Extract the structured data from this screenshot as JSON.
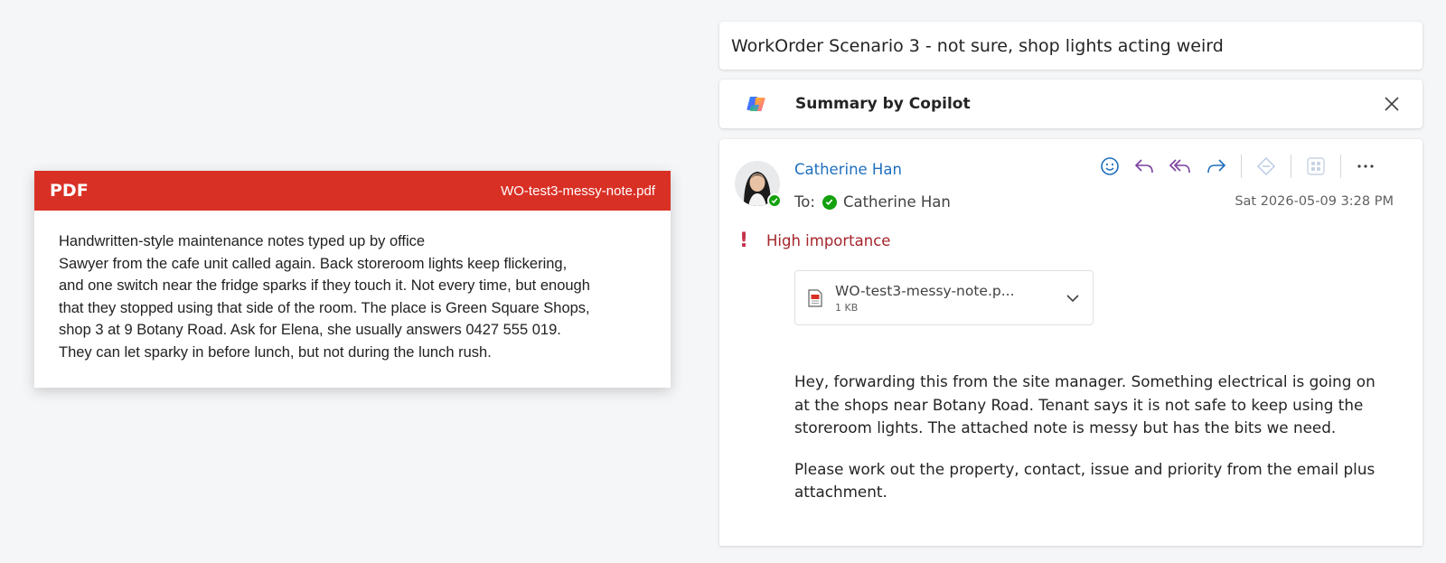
{
  "pdf": {
    "tag": "PDF",
    "filename": "WO-test3-messy-note.pdf",
    "lines": [
      "Handwritten-style maintenance notes typed up by office",
      "Sawyer from the cafe unit called again. Back storeroom lights keep flickering,",
      "and one switch near the fridge sparks if they touch it. Not every time, but enough",
      "that they stopped using that side of the room. The place is Green Square Shops,",
      "shop 3 at 9 Botany Road. Ask for Elena, she usually answers 0427 555 019.",
      "They can let sparky in before lunch, but not during the lunch rush."
    ]
  },
  "email": {
    "subject": "WorkOrder Scenario 3 - not sure, shop lights acting weird",
    "copilot_label": "Summary by Copilot",
    "sender": "Catherine Han",
    "to_label": "To:",
    "recipient": "Catherine Han",
    "date": "Sat 2026-05-09 3:28 PM",
    "importance": "High importance",
    "attachment": {
      "name": "WO-test3-messy-note.p...",
      "size": "1 KB"
    },
    "body": [
      "Hey, forwarding this from the site manager. Something electrical is going on at the shops near Botany Road. Tenant says it is not safe to keep using the storeroom lights. The attached note is messy but has the bits we need.",
      "Please work out the property, contact, issue and priority from the email plus attachment."
    ],
    "actions": [
      "emoji-icon",
      "reply-icon",
      "reply-all-icon",
      "forward-icon",
      "sensitivity-icon",
      "apps-icon",
      "more-icon"
    ]
  },
  "colors": {
    "pdf_header": "#d93025",
    "link_blue": "#1f6fbf",
    "importance_red": "#a4262c",
    "presence_green": "#13a10e"
  }
}
